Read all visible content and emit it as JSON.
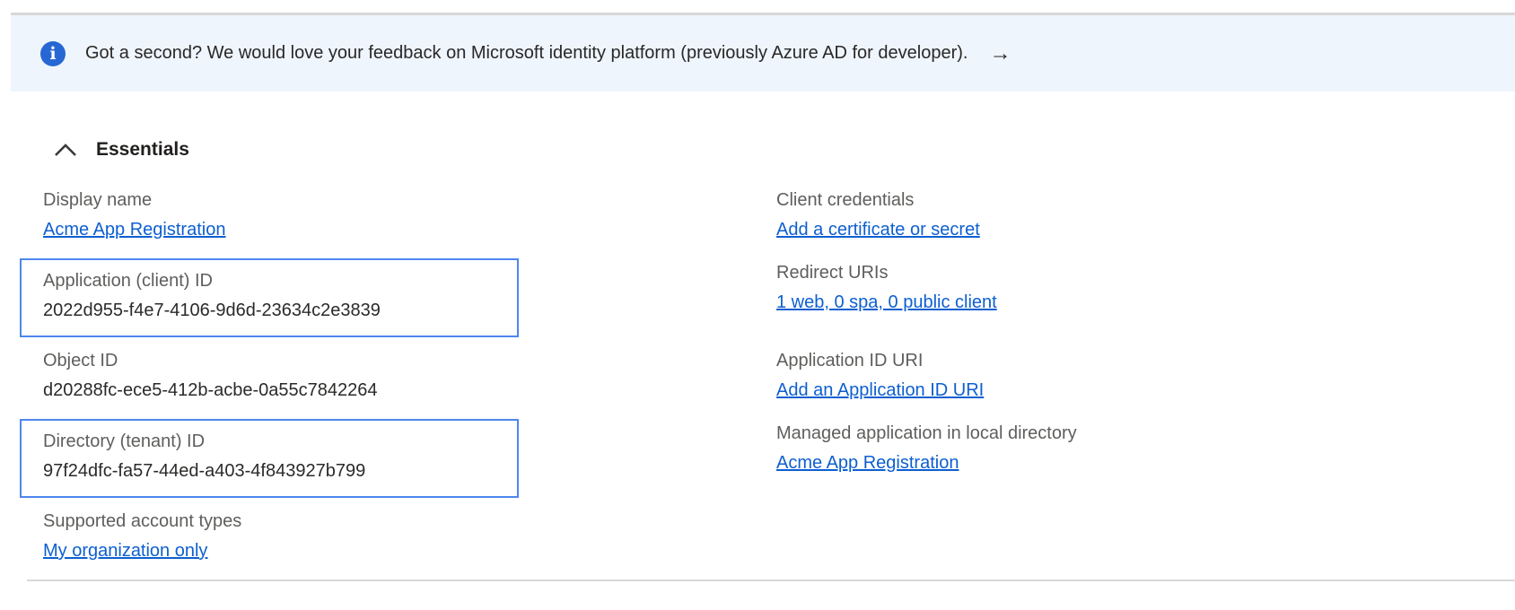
{
  "banner": {
    "text": "Got a second? We would love your feedback on Microsoft identity platform (previously Azure AD for developer).",
    "arrow": "→"
  },
  "essentials": {
    "title": "Essentials",
    "left": [
      {
        "label": "Display name",
        "value": "Acme App Registration"
      },
      {
        "label": "Application (client) ID",
        "value": "2022d955-f4e7-4106-9d6d-23634c2e3839"
      },
      {
        "label": "Object ID",
        "value": "d20288fc-ece5-412b-acbe-0a55c7842264"
      },
      {
        "label": "Directory (tenant) ID",
        "value": "97f24dfc-fa57-44ed-a403-4f843927b799"
      },
      {
        "label": "Supported account types",
        "value": "My organization only"
      }
    ],
    "right": [
      {
        "label": "Client credentials",
        "value": "Add a certificate or secret"
      },
      {
        "label": "Redirect URIs",
        "value": "1 web, 0 spa, 0 public client"
      },
      {
        "label": "Application ID URI",
        "value": "Add an Application ID URI"
      },
      {
        "label": "Managed application in local directory",
        "value": "Acme App Registration"
      }
    ]
  },
  "icons": {
    "info": "info-icon",
    "arrow_right": "arrow-right-icon",
    "chevron_up": "chevron-up-icon"
  },
  "colors": {
    "banner_bg": "#eff5fc",
    "info_icon_blue": "#2767d4",
    "link_blue": "#0d5fd0",
    "label_gray": "#5f5e5c",
    "value_dark": "#2b2a29",
    "highlight_border_blue": "#4e86ee",
    "divider_gray": "#d8d8d8"
  }
}
